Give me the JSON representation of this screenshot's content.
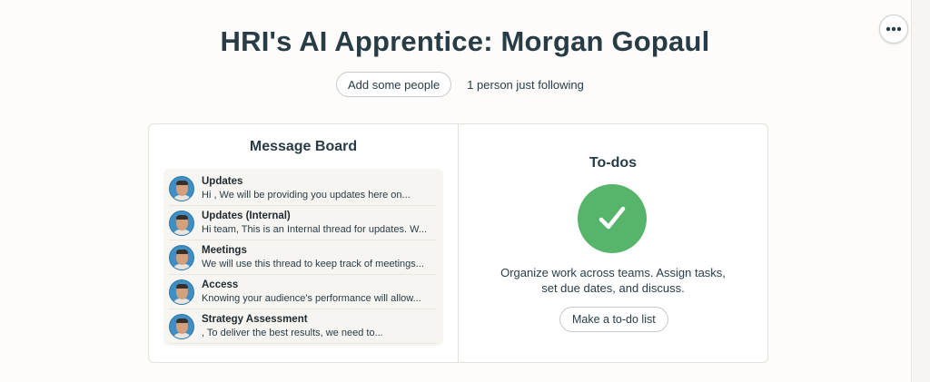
{
  "project": {
    "title": "HRI's AI Apprentice: Morgan Gopaul",
    "add_people_label": "Add some people",
    "following_text": "1 person just following"
  },
  "message_board": {
    "title": "Message Board",
    "messages": [
      {
        "subject": "Updates",
        "excerpt": "Hi , We will be providing you updates here on..."
      },
      {
        "subject": "Updates (Internal)",
        "excerpt": "Hi team, This is an Internal thread for updates. W..."
      },
      {
        "subject": "Meetings",
        "excerpt": "We will use this thread to keep track of meetings..."
      },
      {
        "subject": "Access",
        "excerpt": "Knowing your audience's performance will allow..."
      },
      {
        "subject": "Strategy Assessment",
        "excerpt": ", To deliver the best results, we need to..."
      }
    ]
  },
  "todos": {
    "title": "To-dos",
    "icon": "checkmark-icon",
    "description": "Organize work across teams. Assign tasks, set due dates, and discuss.",
    "button_label": "Make a to-do list"
  },
  "icons": {
    "more": "more-options-icon",
    "todo": "checkmark-icon",
    "avatar": "user-avatar"
  },
  "colors": {
    "background": "#fdfcfa",
    "text": "#283c46",
    "todo_green": "#56b56a",
    "message_list_bg": "#f7f5f1"
  }
}
